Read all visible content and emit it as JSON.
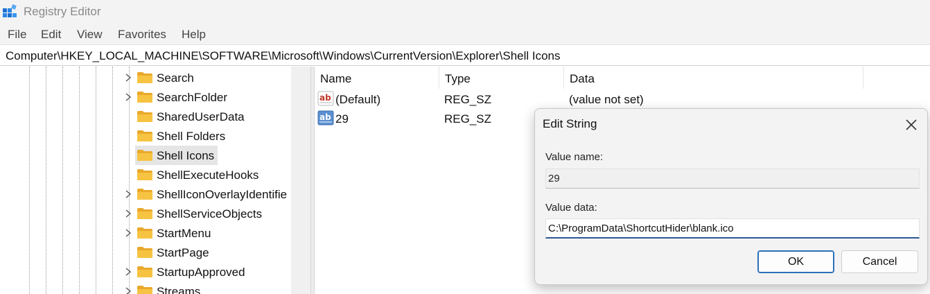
{
  "window": {
    "title": "Registry Editor",
    "icon": "registry-editor-icon"
  },
  "menu": [
    "File",
    "Edit",
    "View",
    "Favorites",
    "Help"
  ],
  "address": "Computer\\HKEY_LOCAL_MACHINE\\SOFTWARE\\Microsoft\\Windows\\CurrentVersion\\Explorer\\Shell Icons",
  "tree": {
    "items": [
      {
        "label": "Search",
        "expandable": true
      },
      {
        "label": "SearchFolder",
        "expandable": true
      },
      {
        "label": "SharedUserData",
        "expandable": false
      },
      {
        "label": "Shell Folders",
        "expandable": false
      },
      {
        "label": "Shell Icons",
        "expandable": false,
        "selected": true
      },
      {
        "label": "ShellExecuteHooks",
        "expandable": false
      },
      {
        "label": "ShellIconOverlayIdentifie",
        "expandable": true
      },
      {
        "label": "ShellServiceObjects",
        "expandable": true
      },
      {
        "label": "StartMenu",
        "expandable": true
      },
      {
        "label": "StartPage",
        "expandable": false
      },
      {
        "label": "StartupApproved",
        "expandable": true
      },
      {
        "label": "Streams",
        "expandable": true
      }
    ]
  },
  "list": {
    "columns": [
      "Name",
      "Type",
      "Data"
    ],
    "rows": [
      {
        "name": "(Default)",
        "type": "REG_SZ",
        "data": "(value not set)",
        "icon": "string-value-icon"
      },
      {
        "name": "29",
        "type": "REG_SZ",
        "data": "",
        "icon": "string-value-selected-icon"
      }
    ]
  },
  "dialog": {
    "title": "Edit String",
    "value_name_label": "Value name:",
    "value_name": "29",
    "value_data_label": "Value data:",
    "value_data": "C:\\ProgramData\\ShortcutHider\\blank.ico",
    "ok_label": "OK",
    "cancel_label": "Cancel"
  },
  "colors": {
    "accent": "#2a6fb8",
    "folder": "#f6c343",
    "selection": "#e5e5e5"
  }
}
